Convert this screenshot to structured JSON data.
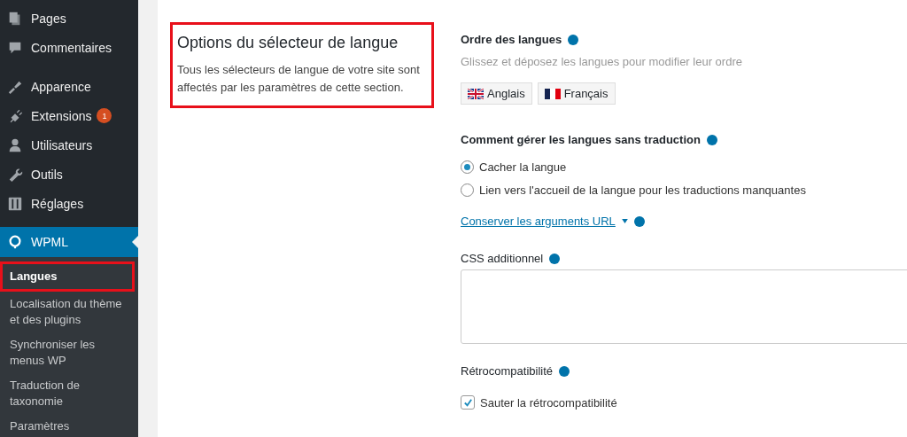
{
  "sidebar": {
    "items": [
      {
        "label": "Pages",
        "selected": false
      },
      {
        "label": "Commentaires",
        "selected": false
      },
      {
        "label": "Apparence",
        "selected": false
      },
      {
        "label": "Extensions",
        "selected": false,
        "badge": "1"
      },
      {
        "label": "Utilisateurs",
        "selected": false
      },
      {
        "label": "Outils",
        "selected": false
      },
      {
        "label": "Réglages",
        "selected": false
      },
      {
        "label": "WPML",
        "selected": true
      }
    ],
    "submenu": [
      {
        "label": "Langues",
        "selected": true,
        "highlighted": true
      },
      {
        "label": "Localisation du thème et des plugins",
        "selected": false,
        "highlighted": false
      },
      {
        "label": "Synchroniser les menus WP",
        "selected": false,
        "highlighted": false
      },
      {
        "label": "Traduction de taxonomie",
        "selected": false,
        "highlighted": false
      },
      {
        "label": "Paramètres",
        "selected": false,
        "highlighted": false
      }
    ]
  },
  "section": {
    "title": "Options du sélecteur de langue",
    "description": "Tous les sélecteurs de langue de votre site sont affectés par les paramètres de cette section.",
    "highlighted": true
  },
  "order": {
    "label": "Ordre des langues",
    "hint": "Glissez et déposez les langues pour modifier leur ordre",
    "languages": [
      {
        "label": "Anglais"
      },
      {
        "label": "Français"
      }
    ]
  },
  "missing": {
    "label": "Comment gérer les langues sans traduction",
    "options": [
      {
        "label": "Cacher la langue",
        "selected": true
      },
      {
        "label": "Lien vers l'accueil de la langue pour les traductions manquantes",
        "selected": false
      }
    ]
  },
  "url_link": "Conserver les arguments URL",
  "css": {
    "label": "CSS additionnel"
  },
  "compat": {
    "label": "Rétrocompatibilité",
    "checkbox": {
      "label": "Sauter la rétrocompatibilité",
      "checked": true
    }
  }
}
